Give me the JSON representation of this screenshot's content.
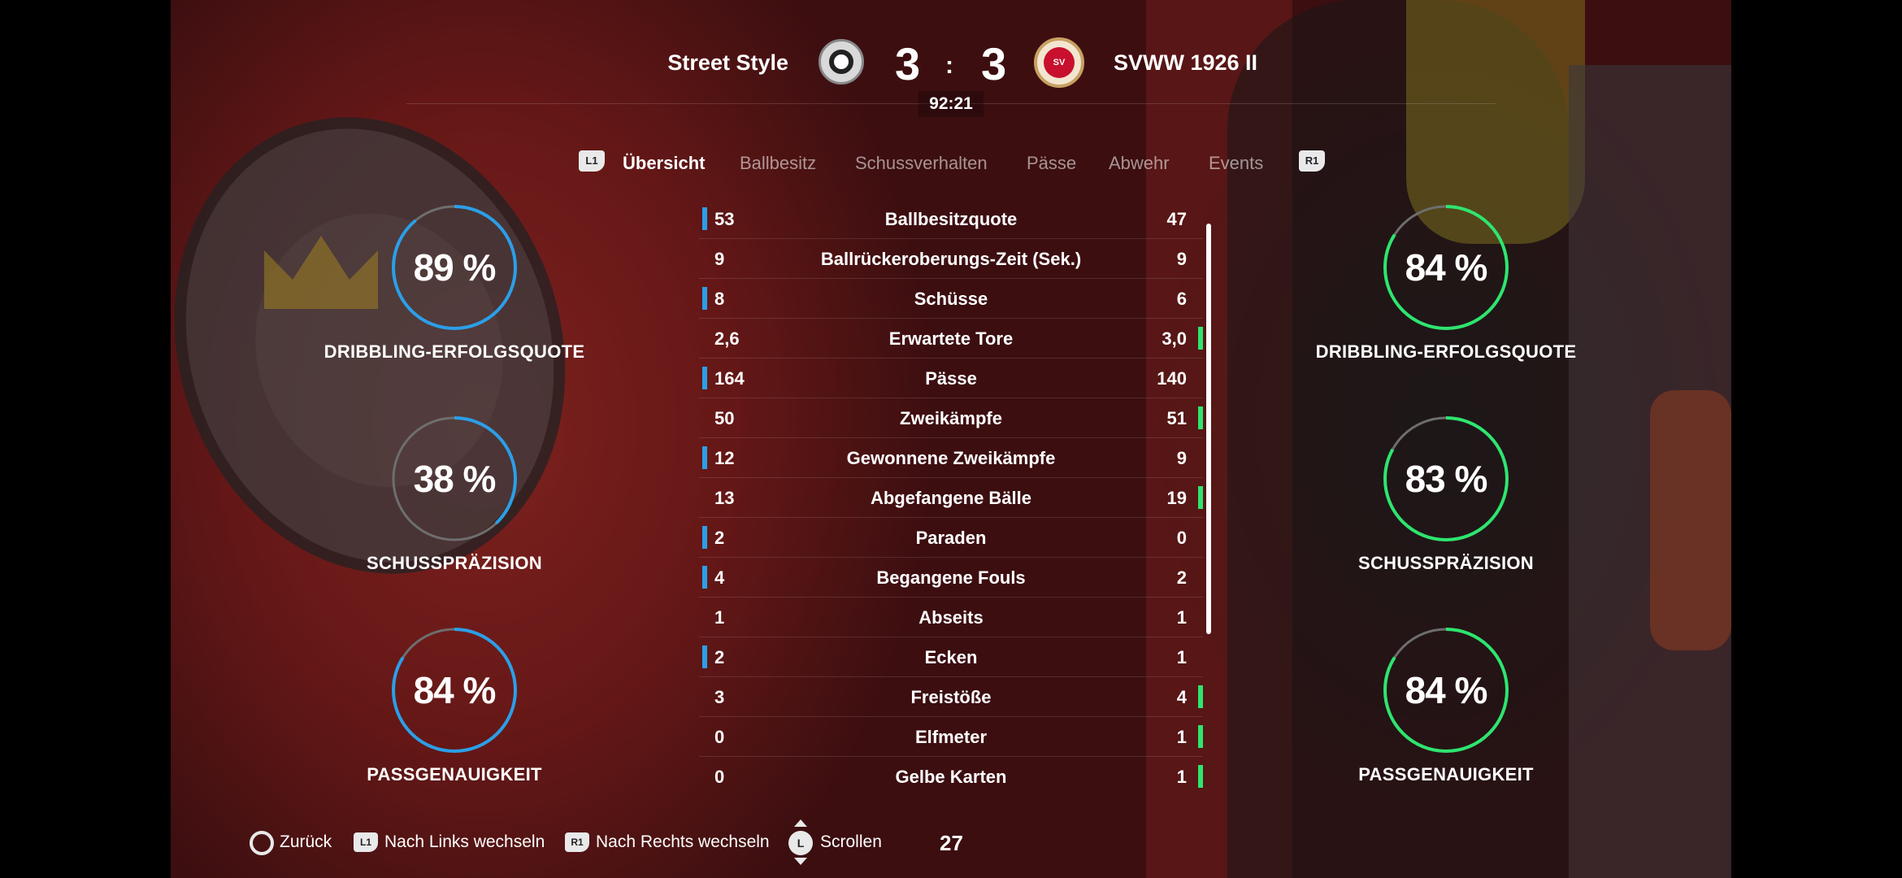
{
  "match": {
    "home_team": "Street Style",
    "away_team": "SVWW 1926 II",
    "home_score": "3",
    "separator": ":",
    "away_score": "3",
    "match_time": "92:21",
    "away_crest_text": "SV"
  },
  "tabs": {
    "prev_button": "L1",
    "next_button": "R1",
    "items": [
      "Übersicht",
      "Ballbesitz",
      "Schussverhalten",
      "Pässe",
      "Abwehr",
      "Events"
    ],
    "active_index": 0
  },
  "home_rings": [
    {
      "value_text": "89 %",
      "value": 0.89,
      "label": "DRIBBLING-ERFOLGSQUOTE"
    },
    {
      "value_text": "38 %",
      "value": 0.38,
      "label": "SCHUSSPRÄZISION"
    },
    {
      "value_text": "84 %",
      "value": 0.84,
      "label": "PASSGENAUIGKEIT"
    }
  ],
  "away_rings": [
    {
      "value_text": "84 %",
      "value": 0.84,
      "label": "DRIBBLING-ERFOLGSQUOTE"
    },
    {
      "value_text": "83 %",
      "value": 0.83,
      "label": "SCHUSSPRÄZISION"
    },
    {
      "value_text": "84 %",
      "value": 0.84,
      "label": "PASSGENAUIGKEIT"
    }
  ],
  "stats": [
    {
      "home": "53",
      "label": "Ballbesitzquote",
      "away": "47",
      "leader": "home"
    },
    {
      "home": "9",
      "label": "Ballrückeroberungs-Zeit (Sek.)",
      "away": "9",
      "leader": "none"
    },
    {
      "home": "8",
      "label": "Schüsse",
      "away": "6",
      "leader": "home"
    },
    {
      "home": "2,6",
      "label": "Erwartete Tore",
      "away": "3,0",
      "leader": "away"
    },
    {
      "home": "164",
      "label": "Pässe",
      "away": "140",
      "leader": "home"
    },
    {
      "home": "50",
      "label": "Zweikämpfe",
      "away": "51",
      "leader": "away"
    },
    {
      "home": "12",
      "label": "Gewonnene Zweikämpfe",
      "away": "9",
      "leader": "home"
    },
    {
      "home": "13",
      "label": "Abgefangene Bälle",
      "away": "19",
      "leader": "away"
    },
    {
      "home": "2",
      "label": "Paraden",
      "away": "0",
      "leader": "home"
    },
    {
      "home": "4",
      "label": "Begangene Fouls",
      "away": "2",
      "leader": "home"
    },
    {
      "home": "1",
      "label": "Abseits",
      "away": "1",
      "leader": "none"
    },
    {
      "home": "2",
      "label": "Ecken",
      "away": "1",
      "leader": "home"
    },
    {
      "home": "3",
      "label": "Freistöße",
      "away": "4",
      "leader": "away"
    },
    {
      "home": "0",
      "label": "Elfmeter",
      "away": "1",
      "leader": "away"
    },
    {
      "home": "0",
      "label": "Gelbe Karten",
      "away": "1",
      "leader": "away"
    }
  ],
  "footer": {
    "back": "Zurück",
    "l1_badge": "L1",
    "left": "Nach Links wechseln",
    "r1_badge": "R1",
    "right": "Nach Rechts wechseln",
    "stick_badge": "L",
    "scroll": "Scrollen",
    "page": "27"
  },
  "colors": {
    "home_accent": "#2b9fe8",
    "away_accent": "#2ee56f",
    "ring_track": "#6e6e6e"
  }
}
